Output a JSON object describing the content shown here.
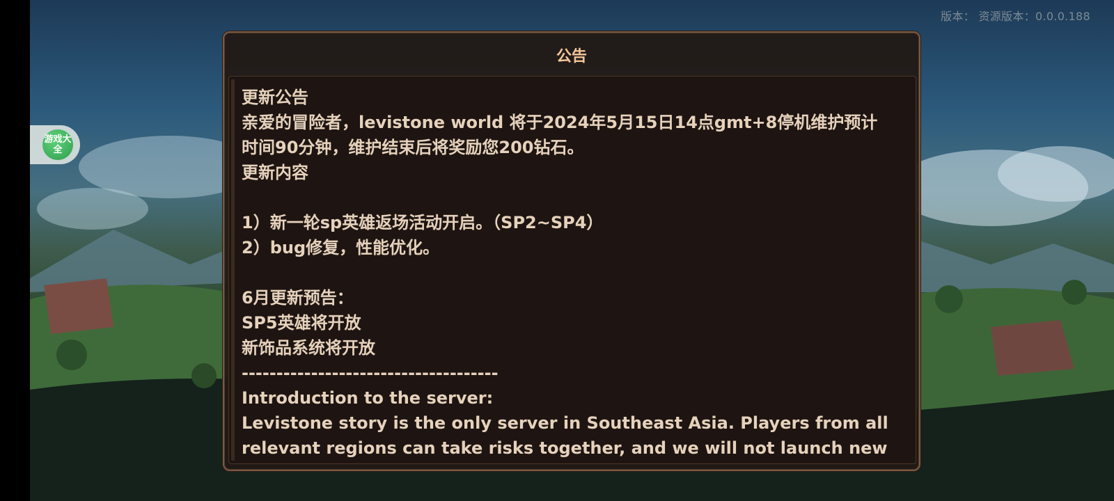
{
  "version_text": "版本：  资源版本：0.0.0.188",
  "side_badge": {
    "text": "游戏大全"
  },
  "dialog": {
    "title": "公告",
    "lines": [
      "更新公告",
      "亲爱的冒险者，levistone world 将于2024年5月15日14点gmt+8停机维护预计",
      "时间90分钟，维护结束后将奖励您200钻石。",
      "更新内容",
      "",
      "1）新一轮sp英雄返场活动开启。（SP2~SP4）",
      "2）bug修复，性能优化。",
      "",
      "6月更新预告：",
      "SP5英雄将开放",
      "新饰品系统将开放",
      "-------------------------------------",
      "Introduction to the server:",
      "Levistone story is the only server in Southeast Asia. Players from all",
      "relevant regions can take risks together, and we will not launch new"
    ]
  },
  "colors": {
    "title": "#f3c79a",
    "text": "#e6d2bc",
    "panel": "#1e1512",
    "border": "#7a5a42"
  }
}
